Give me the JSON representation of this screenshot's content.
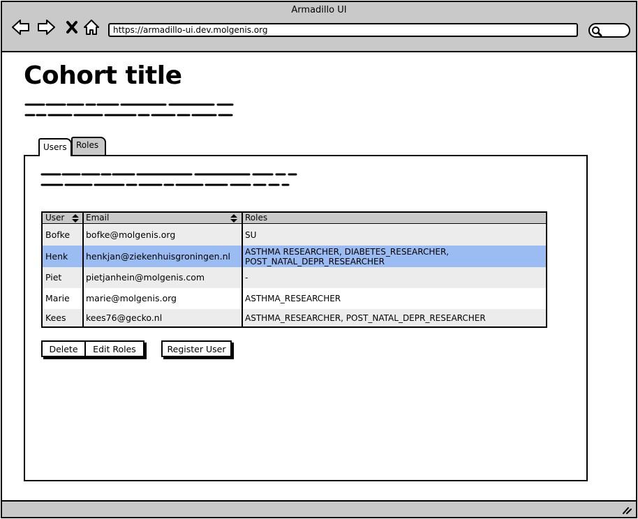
{
  "window": {
    "title": "Armadillo UI"
  },
  "browser": {
    "url": "https://armadillo-ui.dev.molgenis.org"
  },
  "page": {
    "title": "Cohort title"
  },
  "tabs": [
    {
      "label": "Users",
      "active": true
    },
    {
      "label": "Roles",
      "active": false
    }
  ],
  "table": {
    "columns": [
      "User",
      "Email",
      "Roles"
    ],
    "rows": [
      {
        "user": "Bofke",
        "email": "bofke@molgenis.org",
        "roles": [
          "SU"
        ]
      },
      {
        "user": "Henk",
        "email": "henkjan@ziekenhuisgroningen.nl",
        "roles": [
          "ASTHMA RESEARCHER, DIABETES_RESEARCHER,",
          "POST_NATAL_DEPR_RESEARCHER"
        ],
        "selected": true
      },
      {
        "user": "Piet",
        "email": "pietjanhein@molgenis.com",
        "roles": [
          "-"
        ]
      },
      {
        "user": "Marie",
        "email": "marie@molgenis.org",
        "roles": [
          "ASTHMA_RESEARCHER"
        ]
      },
      {
        "user": "Kees",
        "email": "kees76@gecko.nl",
        "roles": [
          "ASTHMA_RESEARCHER, POST_NATAL_DEPR_RESEARCHER"
        ]
      }
    ]
  },
  "actions": {
    "delete_label": "Delete",
    "edit_roles_label": "Edit Roles",
    "register_user_label": "Register User"
  },
  "colors": {
    "chrome": "#c9c9c9",
    "selected_row": "#9bbcf2",
    "striped_row": "#ececec"
  },
  "icons": [
    "back-arrow-icon",
    "forward-arrow-icon",
    "close-icon",
    "home-icon",
    "search-icon",
    "sort-icon",
    "resize-grip-icon"
  ]
}
